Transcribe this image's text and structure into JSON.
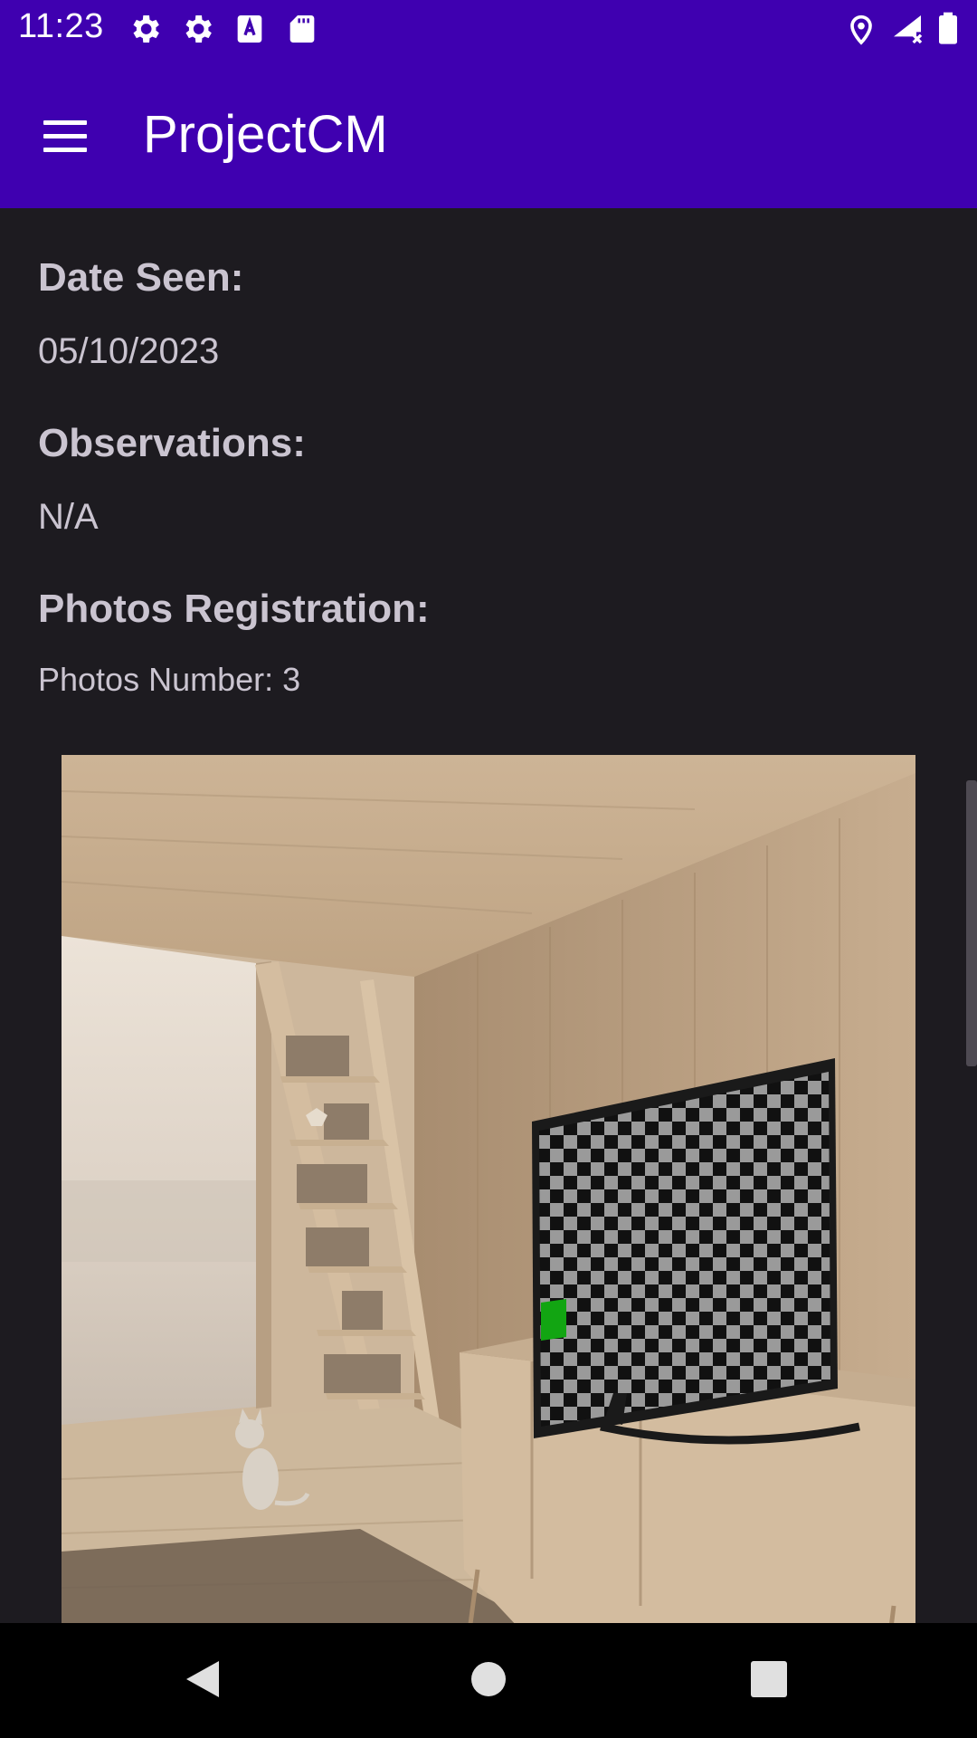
{
  "status_bar": {
    "time": "11:23",
    "left_icons": [
      "gear-icon",
      "gear-icon",
      "text-a-icon",
      "sd-card-icon"
    ],
    "right_icons": [
      "location-pin-icon",
      "signal-no-data-icon",
      "battery-icon"
    ]
  },
  "app_bar": {
    "title": "ProjectCM",
    "menu_icon": "hamburger-menu-icon",
    "color": "#3f00b0"
  },
  "details": {
    "date_seen_label": "Date Seen:",
    "date_seen_value": "05/10/2023",
    "observations_label": "Observations:",
    "observations_value": "N/A",
    "photos_label": "Photos Registration:",
    "photos_count_text": "Photos Number: 3"
  },
  "photo": {
    "icon": "room-photo-image"
  },
  "nav_bar": {
    "buttons": [
      "back-triangle-icon",
      "home-circle-icon",
      "recents-square-icon"
    ]
  },
  "colors": {
    "background": "#1d1b20",
    "text": "#cac4d0",
    "accent": "#3f00b0"
  }
}
